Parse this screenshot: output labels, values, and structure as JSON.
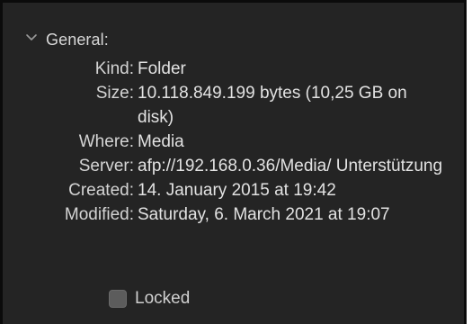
{
  "section": {
    "title": "General:",
    "chevron_icon": "chevron-down-icon"
  },
  "info": {
    "rows": [
      {
        "label": "Kind:",
        "value": "Folder"
      },
      {
        "label": "Size:",
        "value": "10.118.849.199 bytes (10,25 GB on disk)"
      },
      {
        "label": "Where:",
        "value": "Media"
      },
      {
        "label": "Server:",
        "value": "afp://192.168.0.36/Media/ Unterstützung"
      },
      {
        "label": "Created:",
        "value": "14. January 2015 at 19:42"
      },
      {
        "label": "Modified:",
        "value": "Saturday, 6. March 2021 at 19:07"
      }
    ]
  },
  "locked": {
    "label": "Locked",
    "checked": false
  },
  "colors": {
    "panel_background": "#242424",
    "text": "#e2e2e2",
    "checkbox": "#5c5c5c"
  }
}
